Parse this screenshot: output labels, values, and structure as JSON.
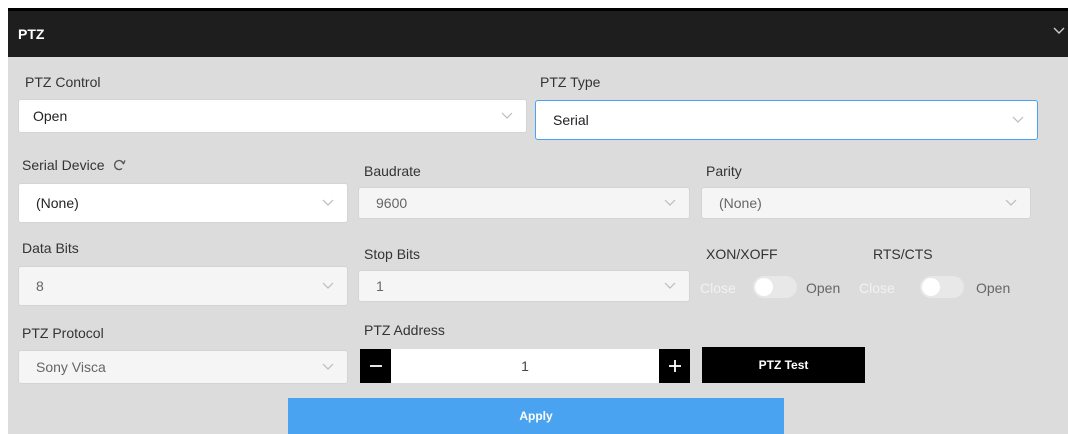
{
  "header": {
    "title": "PTZ",
    "collapse_icon": "chevron-down-icon"
  },
  "ptz_control": {
    "label": "PTZ Control",
    "value": "Open"
  },
  "ptz_type": {
    "label": "PTZ Type",
    "value": "Serial"
  },
  "serial_device": {
    "label": "Serial Device",
    "refresh_icon": "refresh-icon",
    "value": "(None)"
  },
  "baudrate": {
    "label": "Baudrate",
    "value": "9600"
  },
  "parity": {
    "label": "Parity",
    "value": "(None)"
  },
  "data_bits": {
    "label": "Data Bits",
    "value": "8"
  },
  "stop_bits": {
    "label": "Stop Bits",
    "value": "1"
  },
  "xon_xoff": {
    "label": "XON/XOFF",
    "off_label": "Close",
    "on_label": "Open",
    "state": "Close"
  },
  "rts_cts": {
    "label": "RTS/CTS",
    "off_label": "Close",
    "on_label": "Open",
    "state": "Close"
  },
  "ptz_protocol": {
    "label": "PTZ Protocol",
    "value": "Sony Visca"
  },
  "ptz_address": {
    "label": "PTZ Address",
    "value": "1",
    "minus_icon": "minus-icon",
    "plus_icon": "plus-icon"
  },
  "ptz_test_label": "PTZ Test",
  "apply_label": "Apply",
  "colors": {
    "header": "#1e1e1e",
    "panel": "#dcdcdc",
    "accent": "#4aa3f0",
    "button": "#000000"
  }
}
